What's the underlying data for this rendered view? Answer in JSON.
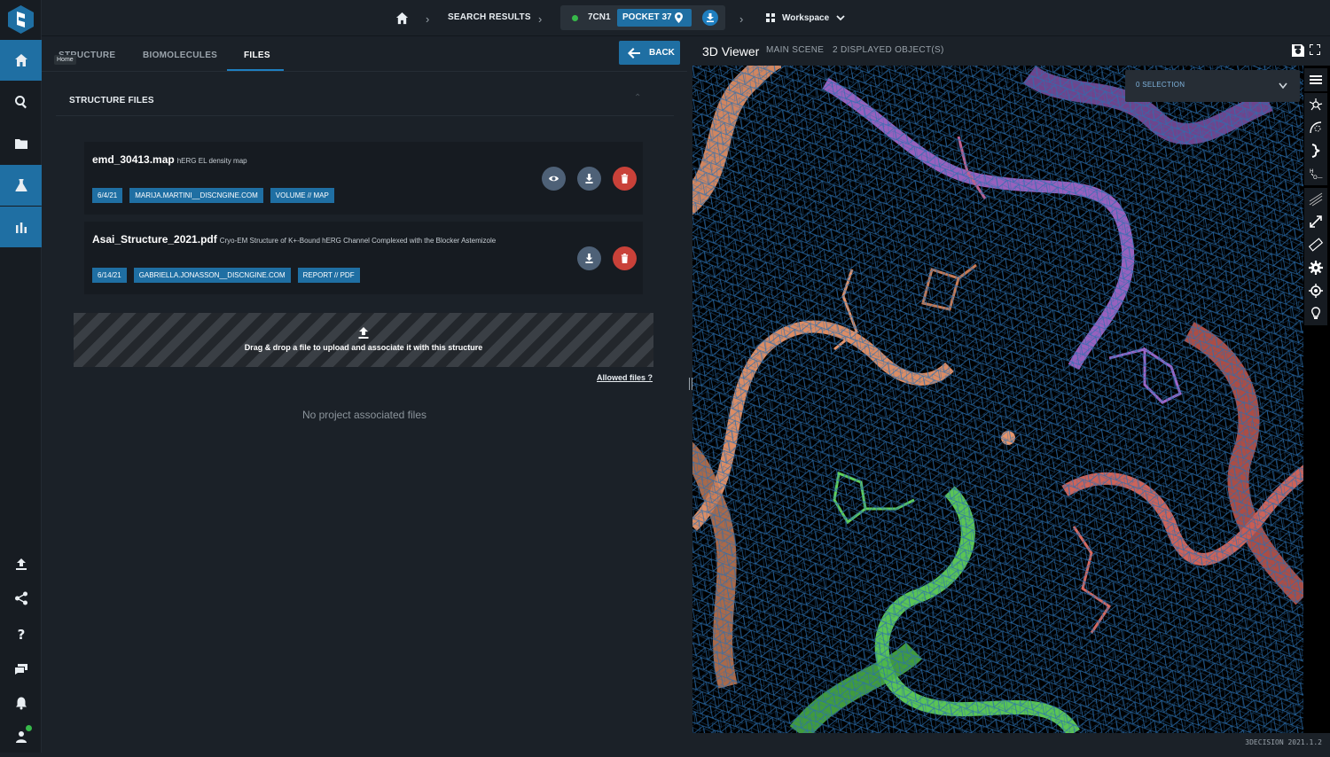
{
  "app": {
    "version": "3DECISION 2021.1.2"
  },
  "sidebar": {
    "tooltip": "Home",
    "top_items": [
      {
        "name": "home-icon",
        "active": true
      },
      {
        "name": "search-icon",
        "active": false
      },
      {
        "name": "folder-icon",
        "active": false
      },
      {
        "name": "flask-icon",
        "active": true
      },
      {
        "name": "bar-chart-icon",
        "active": true
      }
    ],
    "bottom_items": [
      "upload-icon",
      "share-icon",
      "help-icon",
      "chat-icon",
      "bell-icon",
      "user-icon"
    ]
  },
  "breadcrumb": {
    "search_results": "SEARCH RESULTS",
    "structure_id": "7CN1",
    "pocket": "POCKET 37",
    "workspace": "Workspace"
  },
  "tabs": {
    "structure": "STRUCTURE",
    "biomolecules": "BIOMOLECULES",
    "files": "FILES",
    "back": "BACK"
  },
  "structure_files": {
    "title": "STRUCTURE FILES",
    "files": [
      {
        "name": "emd_30413.map",
        "description": "hERG EL density map",
        "date": "6/4/21",
        "user": "MARIJA.MARTINI__DISCNGINE.COM",
        "type": "VOLUME // MAP",
        "actions": [
          "eye-icon",
          "download-icon",
          "trash-icon"
        ]
      },
      {
        "name": "Asai_Structure_2021.pdf",
        "description": "Cryo-EM Structure of K+-Bound hERG Channel Complexed with the Blocker Astemizole",
        "date": "6/14/21",
        "user": "GABRIELLA.JONASSON__DISCNGINE.COM",
        "type": "REPORT // PDF",
        "actions": [
          "download-icon",
          "trash-icon"
        ]
      }
    ],
    "dropzone_text": "Drag & drop a file to upload and associate it with this structure",
    "allowed_files": "Allowed files",
    "allowed_files_q": "?",
    "no_project_files": "No project associated files"
  },
  "viewer": {
    "title": "3D Viewer",
    "scene": "MAIN SCENE",
    "objects": "2 DISPLAYED OBJECT(S)",
    "selection": "0 SELECTION",
    "tools": [
      "menu-icon",
      "molecule-icon",
      "surface-icon",
      "ribbon-icon",
      "ligand-icon",
      "density-icon",
      "resize-icon",
      "ruler-icon",
      "gear-icon",
      "target-icon",
      "lightbulb-icon"
    ]
  },
  "colors": {
    "accent": "#1f6fa3",
    "danger": "#c94139",
    "mesh": "#2a6fb0",
    "chain_orange": "#e8956a",
    "chain_purple": "#a066c8",
    "chain_green": "#5fd05a",
    "chain_salmon": "#d9685e"
  }
}
